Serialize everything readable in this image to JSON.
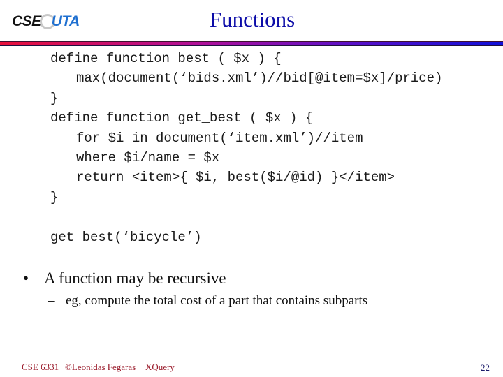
{
  "header": {
    "logo": {
      "left": "CSE",
      "right": "UTA",
      "icon": "at-sign-icon"
    },
    "title": "Functions",
    "bar_gradient": [
      "#e8103a",
      "#1010d8"
    ]
  },
  "code_lines": [
    {
      "text": "define function best ( $x ) {",
      "indent": false
    },
    {
      "text": "max(document(‘bids.xml’)//bid[@item=$x]/price)",
      "indent": true
    },
    {
      "text": "}",
      "indent": false
    },
    {
      "text": "define function get_best ( $x ) {",
      "indent": false
    },
    {
      "text": "for $i in document(‘item.xml’)//item",
      "indent": true
    },
    {
      "text": "where $i/name = $x",
      "indent": true
    },
    {
      "text": "return <item>{ $i, best($i/@id) }</item>",
      "indent": true
    },
    {
      "text": "}",
      "indent": false
    },
    {
      "text": "",
      "indent": false
    },
    {
      "text": "get_best(‘bicycle’)",
      "indent": false
    }
  ],
  "bullets": [
    {
      "marker": "•",
      "text": "A function may be recursive",
      "sub": [
        {
          "marker": "–",
          "text": "eg, compute the total cost of a part that contains subparts"
        }
      ]
    }
  ],
  "footer": {
    "course": "CSE 6331",
    "author": "©Leonidas Fegaras",
    "topic": "XQuery",
    "page_number": "22"
  }
}
